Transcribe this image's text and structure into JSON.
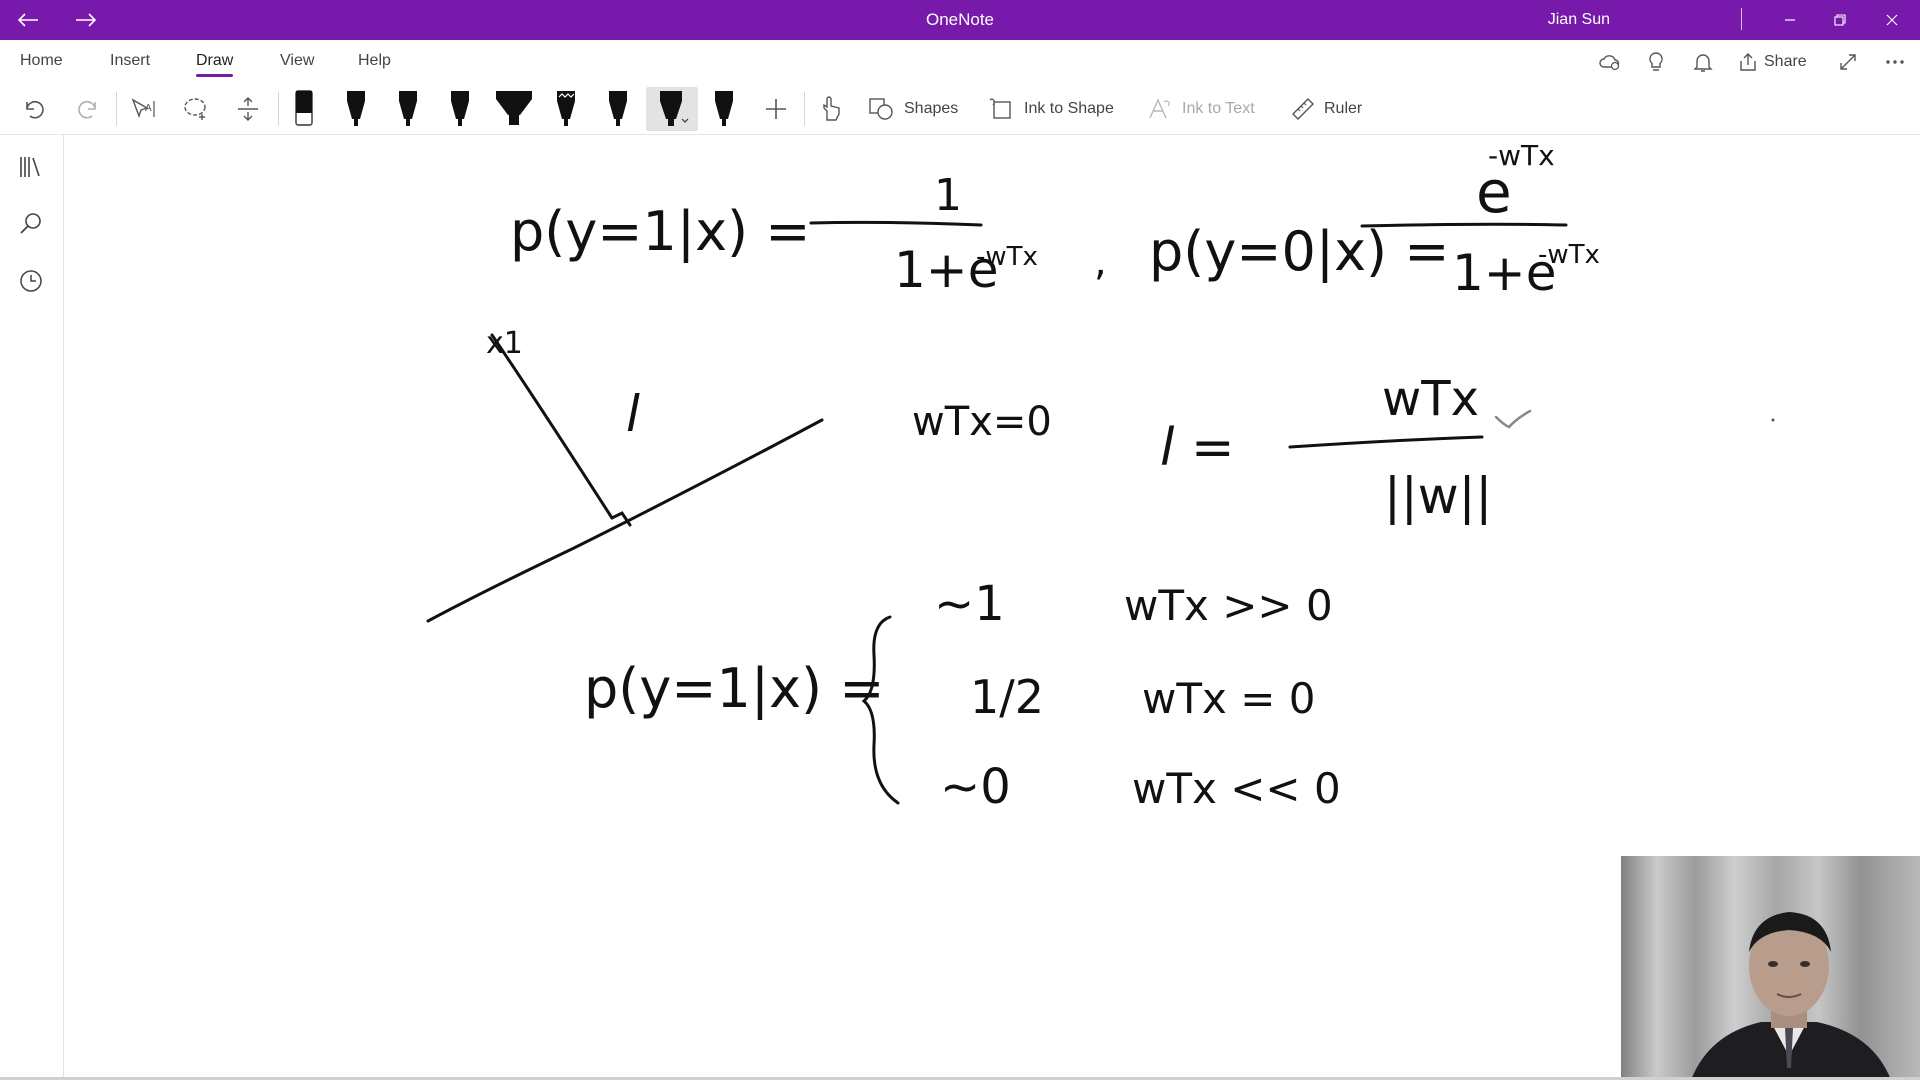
{
  "titlebar": {
    "app_title": "OneNote",
    "user_name": "Jian Sun",
    "back_icon": "arrow-left-icon",
    "forward_icon": "arrow-right-icon",
    "accent_color": "#7719aa"
  },
  "ribbon": {
    "tabs": [
      "Home",
      "Insert",
      "Draw",
      "View",
      "Help"
    ],
    "active_tab": "Draw",
    "share_label": "Share"
  },
  "toolbar": {
    "shapes_label": "Shapes",
    "ink_to_shape_label": "Ink to Shape",
    "ink_to_text_label": "Ink to Text",
    "ruler_label": "Ruler"
  },
  "canvas": {
    "eq_top_left_lhs": "p(y=1|x) =",
    "eq_top_left_num": "1",
    "eq_top_left_den_base": "1+e",
    "eq_top_left_den_exp": "-wTx",
    "eq_comma": ",",
    "eq_top_right_lhs": "p(y=0|x) =",
    "eq_top_right_num_base": "e",
    "eq_top_right_num_exp": "-wTx",
    "eq_top_right_den_base": "1+e",
    "eq_top_right_den_exp": "-wTx",
    "point_label": "x1",
    "distance_label": "l",
    "line_label": "wTx=0",
    "dist_lhs": "l =",
    "dist_num": "wTx",
    "dist_den": "||w||",
    "piece_lhs": "p(y=1|x) =",
    "piece_cases": [
      {
        "value": "~1",
        "condition": "wTx >> 0"
      },
      {
        "value": "1/2",
        "condition": "wTx = 0"
      },
      {
        "value": "~0",
        "condition": "wTx << 0"
      }
    ]
  }
}
